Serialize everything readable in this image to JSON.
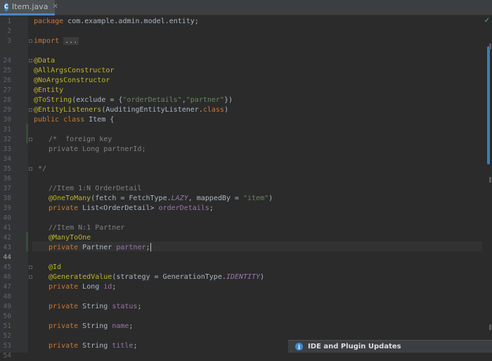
{
  "tab": {
    "label": "Item.java",
    "icon": "class-icon"
  },
  "editor": {
    "current_line": "44",
    "line_numbers": [
      "1",
      "2",
      "3",
      "24",
      "25",
      "26",
      "27",
      "28",
      "29",
      "30",
      "31",
      "32",
      "33",
      "34",
      "35",
      "36",
      "37",
      "38",
      "39",
      "40",
      "41",
      "42",
      "43",
      "44",
      "45",
      "46",
      "47",
      "48",
      "49",
      "50",
      "51",
      "52",
      "53",
      "54"
    ],
    "code": {
      "l1": {
        "kw": "package",
        "rest": " com.example.admin.model.entity;"
      },
      "l3": {
        "kw": "import",
        "dots": "..."
      },
      "l25": "@Data",
      "l26": "@AllArgsConstructor",
      "l27": "@NoArgsConstructor",
      "l28": "@Entity",
      "l29": {
        "ann": "@ToString",
        "a": "(exclude = {",
        "s1": "\"orderDetails\"",
        "comma": ",",
        "s2": "\"partner\"",
        "b": "})"
      },
      "l30": {
        "ann": "@EntityListeners",
        "a": "(AuditingEntityListener.",
        "kw": "class",
        "b": ")"
      },
      "l31": {
        "kw": "public class",
        "rest": " Item {"
      },
      "l33": "/*  foreign key",
      "l34": "private Long partnerId;",
      "l36": " */",
      "l38": "//Item 1:N OrderDetail",
      "l39": {
        "ann": "@OneToMany",
        "a": "(fetch = FetchType.",
        "c": "LAZY",
        "b": ", mappedBy = ",
        "s": "\"item\"",
        "e": ")"
      },
      "l40": {
        "kw": "private",
        "a": " List<OrderDetail> ",
        "f": "orderDetails",
        "e": ";"
      },
      "l42": "//Item N:1 Partner",
      "l43": "@ManyToOne",
      "l44": {
        "kw": "private",
        "a": " Partner ",
        "f": "partner",
        "e": ";"
      },
      "l46": "@Id",
      "l47": {
        "ann": "@GeneratedValue",
        "a": "(strategy = GenerationType.",
        "c": "IDENTITY",
        "e": ")"
      },
      "l48": {
        "kw": "private",
        "a": " Long ",
        "f": "id",
        "e": ";"
      },
      "l50": {
        "kw": "private",
        "a": " String ",
        "f": "status",
        "e": ";"
      },
      "l52": {
        "kw": "private",
        "a": " String ",
        "f": "name",
        "e": ";"
      },
      "l54": {
        "kw": "private",
        "a": " String ",
        "f": "title",
        "e": ";"
      }
    }
  },
  "notification": {
    "title": "IDE and Plugin Updates",
    "icon": "info-icon"
  },
  "status": {
    "inspection_icon": "checkmark-icon"
  },
  "colors": {
    "accent": "#4a88c7",
    "keyword": "#cc7832",
    "annotation": "#bbb529",
    "string": "#6a8759",
    "field": "#9876aa",
    "comment": "#808080"
  }
}
